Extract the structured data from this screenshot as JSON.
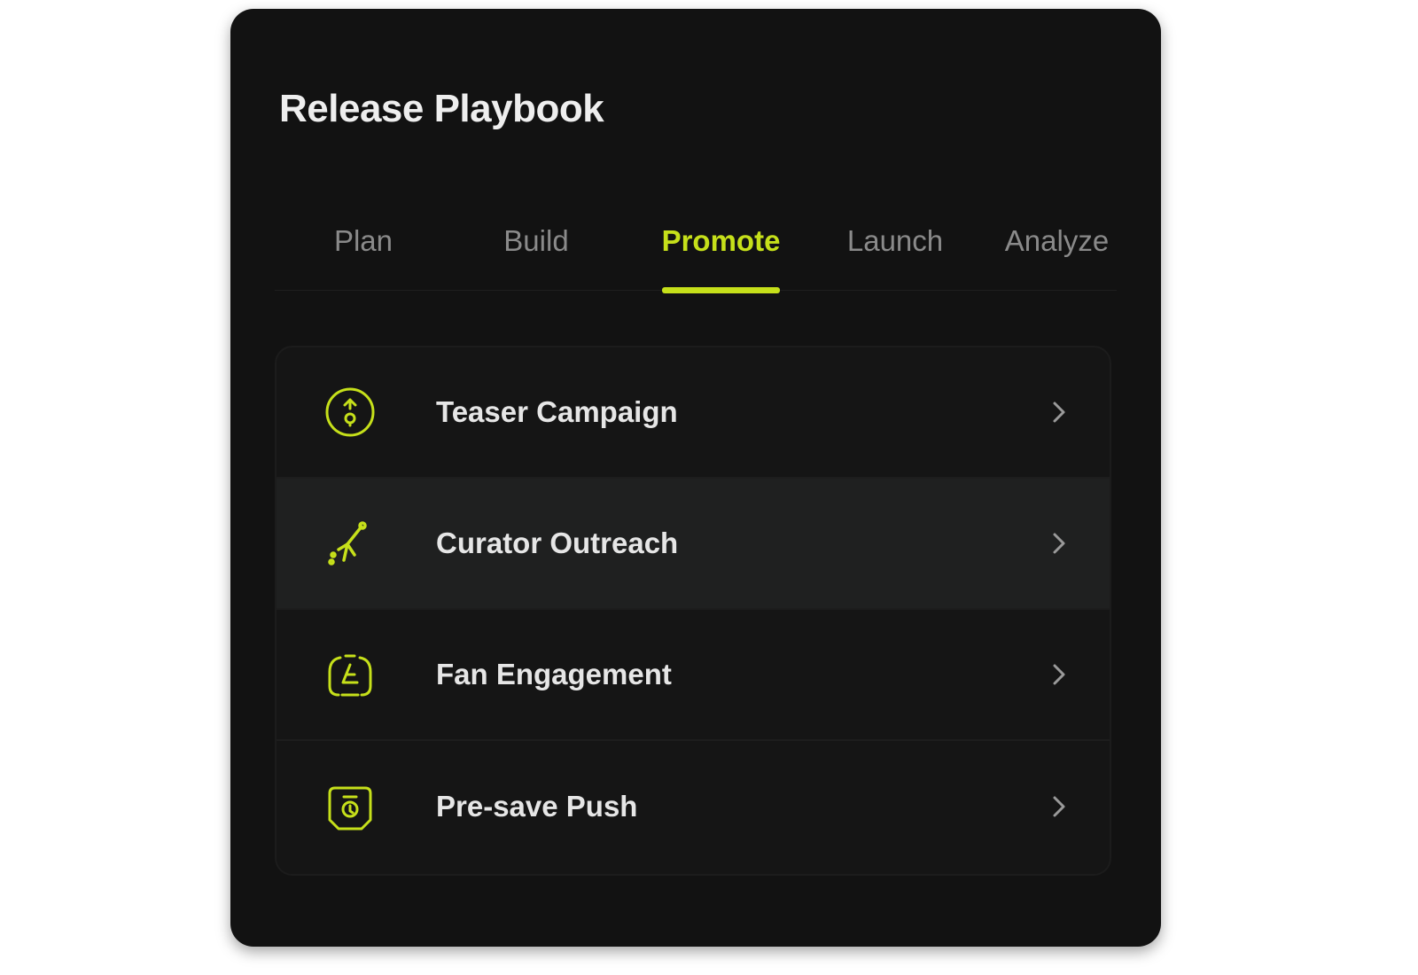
{
  "panel": {
    "title": "Release Playbook"
  },
  "tabs": [
    {
      "label": "Plan",
      "active": false
    },
    {
      "label": "Build",
      "active": false
    },
    {
      "label": "Promote",
      "active": true
    },
    {
      "label": "Launch",
      "active": false
    },
    {
      "label": "Analyze",
      "active": false
    }
  ],
  "items": [
    {
      "label": "Teaser Campaign",
      "icon": "teaser-icon",
      "highlighted": false
    },
    {
      "label": "Curator Outreach",
      "icon": "outreach-icon",
      "highlighted": true
    },
    {
      "label": "Fan Engagement",
      "icon": "fan-engagement-icon",
      "highlighted": false
    },
    {
      "label": "Pre-save Push",
      "icon": "pre-save-icon",
      "highlighted": false
    }
  ],
  "colors": {
    "accent": "#c6e01a",
    "panel_bg": "#121212",
    "row_highlight": "#1f2020",
    "text_primary": "#e6e6e6",
    "text_muted": "#8a8a8a"
  }
}
